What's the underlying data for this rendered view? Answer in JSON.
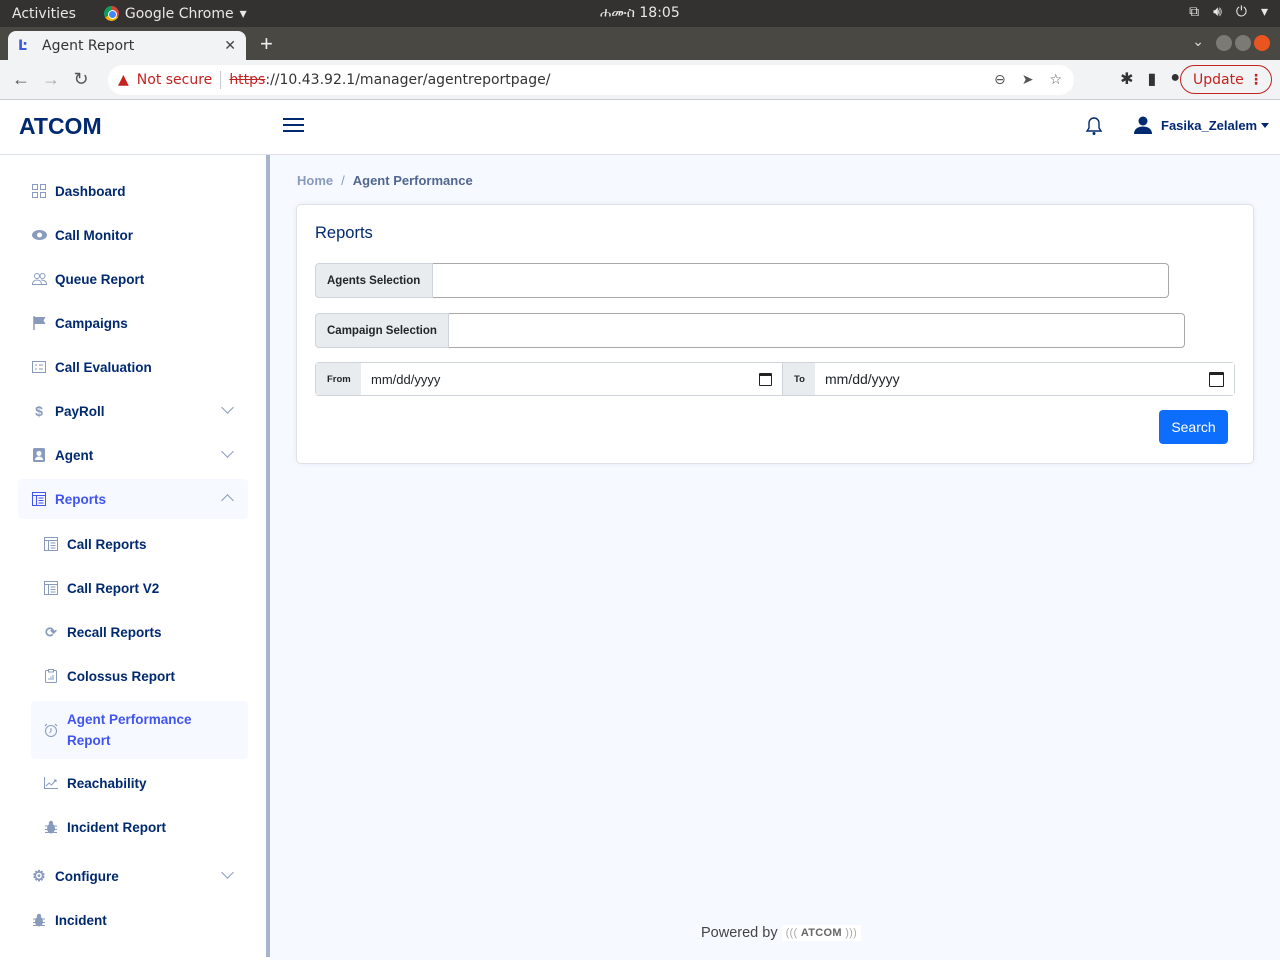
{
  "os": {
    "activities": "Activities",
    "app_name": "Google Chrome",
    "clock": "ሐሙስ 18:05"
  },
  "browser": {
    "tab_title": "Agent Report",
    "security_label": "Not secure",
    "url_scheme": "https",
    "url_rest": "://10.43.92.1/manager/agentreportpage/",
    "update_label": "Update"
  },
  "header": {
    "logo": "ATCOM",
    "username": "Fasika_Zelalem"
  },
  "sidebar": {
    "items": [
      {
        "label": "Dashboard",
        "icon": "grid-icon"
      },
      {
        "label": "Call Monitor",
        "icon": "eye-icon"
      },
      {
        "label": "Queue Report",
        "icon": "people-icon"
      },
      {
        "label": "Campaigns",
        "icon": "flag-icon"
      },
      {
        "label": "Call Evaluation",
        "icon": "checklist-icon"
      },
      {
        "label": "PayRoll",
        "icon": "dollar-icon",
        "expandable": true
      },
      {
        "label": "Agent",
        "icon": "person-badge-icon",
        "expandable": true
      },
      {
        "label": "Reports",
        "icon": "layout-text-icon",
        "expandable": true,
        "expanded": true
      },
      {
        "label": "Configure",
        "icon": "gear-icon",
        "expandable": true
      },
      {
        "label": "Incident",
        "icon": "bug-icon"
      }
    ],
    "report_subitems": [
      {
        "label": "Call Reports",
        "icon": "layout-text-icon"
      },
      {
        "label": "Call Report V2",
        "icon": "layout-text-icon"
      },
      {
        "label": "Recall Reports",
        "icon": "refresh-icon"
      },
      {
        "label": "Colossus Report",
        "icon": "clipboard-chart-icon"
      },
      {
        "label": "Agent Performance Report",
        "icon": "alarm-icon",
        "active": true
      },
      {
        "label": "Reachability",
        "icon": "graph-up-icon"
      },
      {
        "label": "Incident Report",
        "icon": "bug-icon"
      }
    ]
  },
  "breadcrumb": {
    "home": "Home",
    "current": "Agent Performance"
  },
  "form": {
    "title": "Reports",
    "agents_label": "Agents Selection",
    "agents_value": "",
    "campaign_label": "Campaign Selection",
    "campaign_value": "",
    "from_label": "From",
    "from_placeholder": "mm/dd/yyyy",
    "to_label": "To",
    "to_placeholder": "mm/dd/yyyy",
    "search_label": "Search"
  },
  "footer": {
    "powered_by": "Powered by",
    "brand": "ATCOM"
  },
  "colors": {
    "brand": "#012970",
    "active": "#4154f1",
    "primary_button": "#0d6efd",
    "not_secure": "#c5221f"
  }
}
